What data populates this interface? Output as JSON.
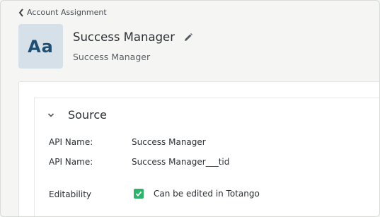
{
  "breadcrumb": {
    "back_label": "Account Assignment"
  },
  "avatar": {
    "initials": "Aa"
  },
  "header": {
    "title": "Success Manager",
    "subtitle": "Success Manager"
  },
  "section": {
    "title": "Source",
    "fields": [
      {
        "label": "API Name:",
        "value": "Success Manager"
      },
      {
        "label": "API Name:",
        "value": "Success Manager___tid"
      }
    ],
    "editability": {
      "label": "Editability",
      "checkbox_label": "Can be edited in Totango",
      "checked": true
    }
  },
  "colors": {
    "accent_green": "#2fb36a",
    "avatar_bg": "#d5e0e9",
    "avatar_text": "#1f4f73"
  }
}
